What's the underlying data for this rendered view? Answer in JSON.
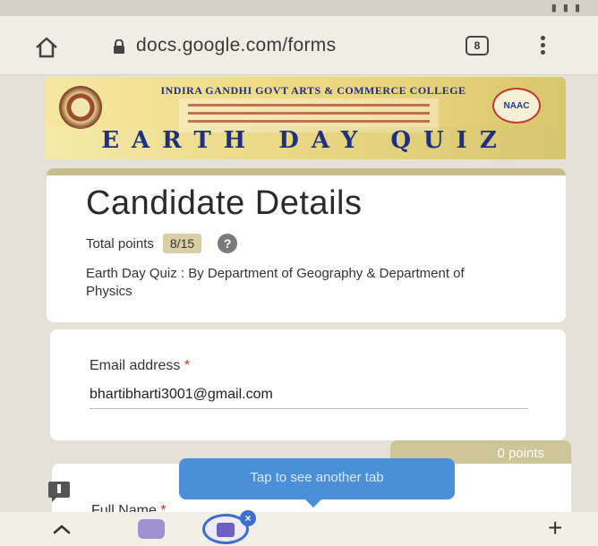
{
  "browser": {
    "url": "docs.google.com/forms",
    "tab_count": "8"
  },
  "banner": {
    "college_name": "INDIRA GANDHI GOVT ARTS & COMMERCE COLLEGE",
    "naac_label": "NAAC",
    "quiz_title": "EARTH DAY QUIZ"
  },
  "form": {
    "title": "Candidate Details",
    "total_points_label": "Total points",
    "score": "8/15",
    "help_glyph": "?",
    "description": "Earth Day Quiz : By Department of Geography & Department of Physics"
  },
  "email": {
    "label": "Email address",
    "required_mark": "*",
    "value": "bhartibharti3001@gmail.com"
  },
  "question": {
    "points_tag": "0 points",
    "label": "Full Name",
    "required_mark": "*"
  },
  "tooltip": {
    "text": "Tap to see another tab"
  },
  "bottom_bar": {
    "new_tab_glyph": "+",
    "close_glyph": "×"
  },
  "icons": [
    "home-icon",
    "lock-icon",
    "tab-switcher-icon",
    "overflow-menu-icon",
    "help-icon",
    "feedback-icon",
    "chevron-up-icon",
    "close-icon",
    "plus-icon"
  ],
  "colors": {
    "accent_blue": "#4a8fd8",
    "score_badge": "#d8cfa6",
    "header_stripe": "#c9bd8e",
    "required": "#c9332b"
  }
}
